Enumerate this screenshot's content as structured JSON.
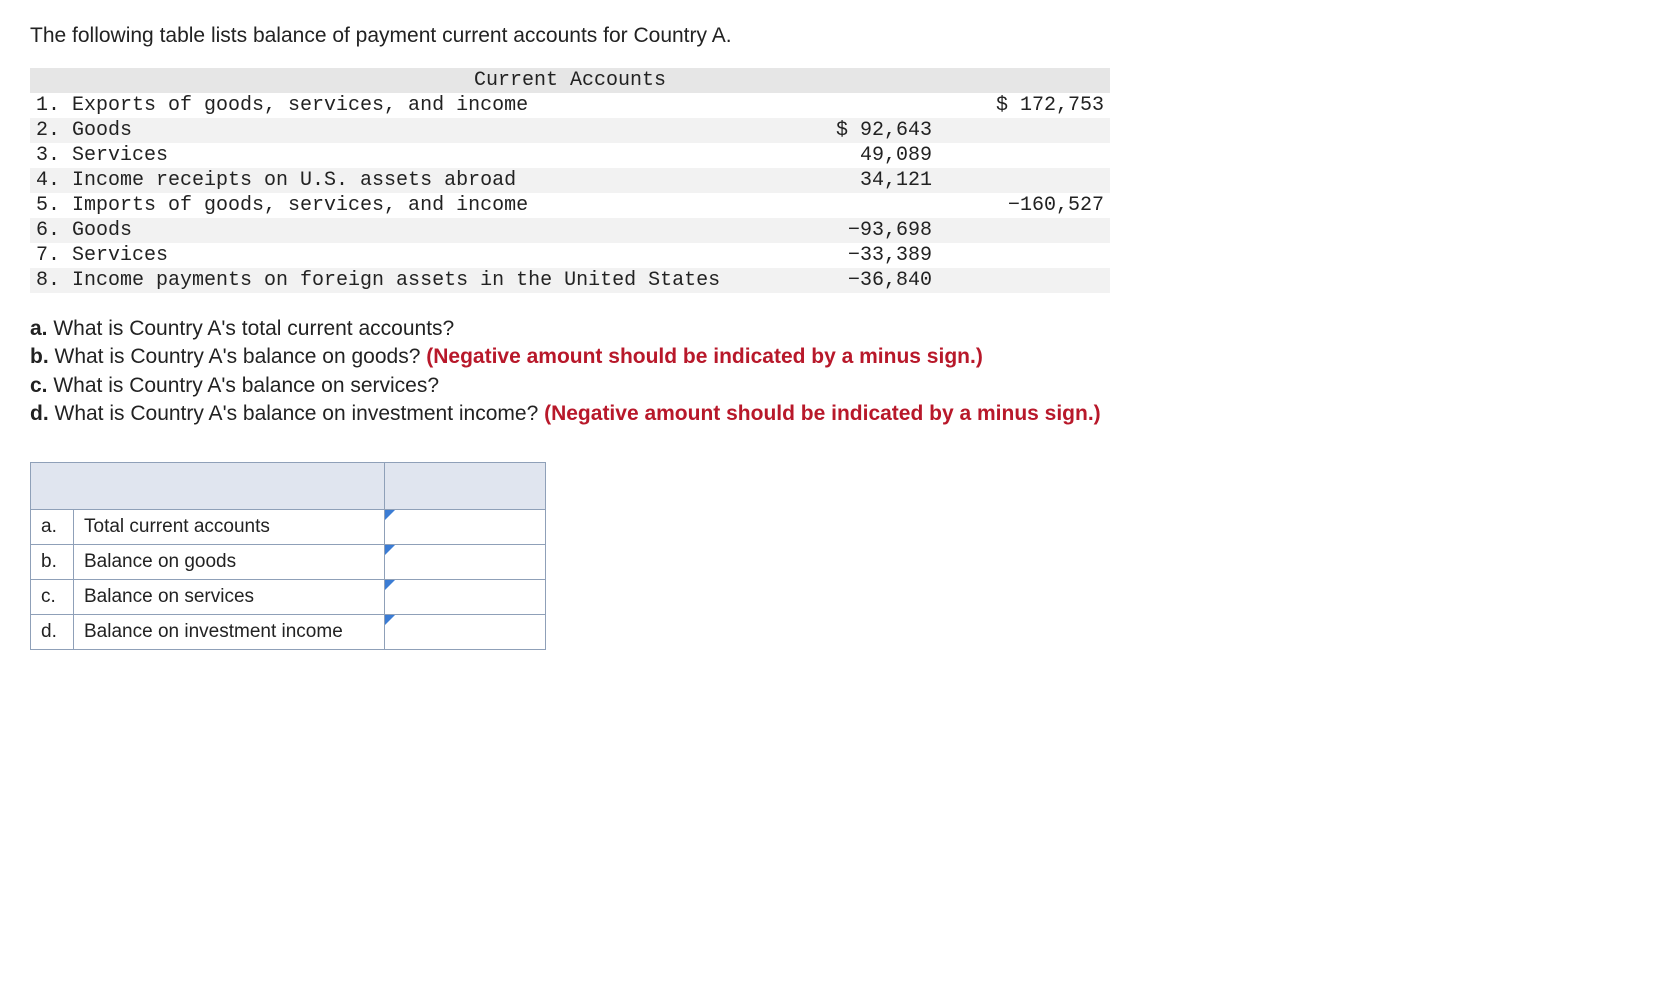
{
  "intro": "The following table lists balance of payment current accounts for Country A.",
  "table": {
    "title": "Current Accounts",
    "rows": [
      {
        "label": "1. Exports of goods, services, and income",
        "sub": "",
        "total": "$ 172,753",
        "shaded": false
      },
      {
        "label": "2. Goods",
        "sub": "$ 92,643",
        "total": "",
        "shaded": true
      },
      {
        "label": "3. Services",
        "sub": "49,089",
        "total": "",
        "shaded": false
      },
      {
        "label": "4. Income receipts on U.S. assets abroad",
        "sub": "34,121",
        "total": "",
        "shaded": true
      },
      {
        "label": "5. Imports of goods, services, and income",
        "sub": "",
        "total": "−160,527",
        "shaded": false
      },
      {
        "label": "6. Goods",
        "sub": "−93,698",
        "total": "",
        "shaded": true
      },
      {
        "label": "7. Services",
        "sub": "−33,389",
        "total": "",
        "shaded": false
      },
      {
        "label": "8. Income payments on foreign assets in the United States",
        "sub": "−36,840",
        "total": "",
        "shaded": true
      }
    ]
  },
  "questions": {
    "a_bold": "a.",
    "a_text": " What is Country A's total current accounts?",
    "b_bold": "b.",
    "b_text": " What is Country A's balance on goods? ",
    "b_red": "(Negative amount should be indicated by a minus sign.)",
    "c_bold": "c.",
    "c_text": " What is Country A's balance on services?",
    "d_bold": "d.",
    "d_text": " What is Country A's balance on investment income? ",
    "d_red": "(Negative amount should be indicated by a minus sign.)"
  },
  "answers": [
    {
      "letter": "a.",
      "label": "Total current accounts",
      "value": ""
    },
    {
      "letter": "b.",
      "label": "Balance on goods",
      "value": ""
    },
    {
      "letter": "c.",
      "label": "Balance on services",
      "value": ""
    },
    {
      "letter": "d.",
      "label": "Balance on investment income",
      "value": ""
    }
  ]
}
